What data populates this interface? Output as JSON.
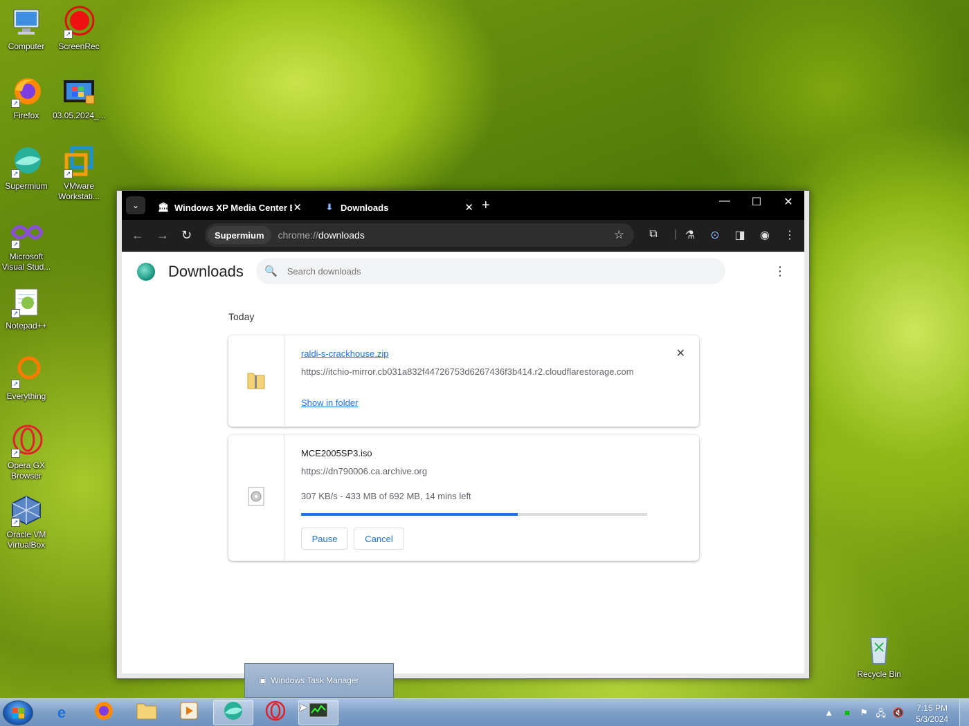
{
  "desktop": {
    "icons": [
      {
        "label": "Computer",
        "icon": "computer-icon"
      },
      {
        "label": "ScreenRec",
        "icon": "screenrec-icon"
      },
      {
        "label": "Firefox",
        "icon": "firefox-icon"
      },
      {
        "label": "03.05.2024_...",
        "icon": "video-file-icon"
      },
      {
        "label": "Supermium",
        "icon": "supermium-icon"
      },
      {
        "label": "VMware Workstati...",
        "icon": "vmware-icon"
      },
      {
        "label": "Microsoft Visual Stud...",
        "icon": "visual-studio-icon"
      },
      {
        "label": "Notepad++",
        "icon": "notepadpp-icon"
      },
      {
        "label": "Everything",
        "icon": "everything-icon"
      },
      {
        "label": "Opera GX Browser",
        "icon": "opera-gx-icon"
      },
      {
        "label": "Oracle VM VirtualBox",
        "icon": "virtualbox-icon"
      },
      {
        "label": "Recycle Bin",
        "icon": "recycle-bin-icon"
      }
    ]
  },
  "browser": {
    "tabs": [
      {
        "title": "Windows XP Media Center Edi",
        "icon": "archive-icon"
      },
      {
        "title": "Downloads",
        "icon": "download-icon"
      }
    ],
    "omnibox": {
      "chip": "Supermium",
      "url_scheme": "chrome://",
      "url_path": "downloads"
    }
  },
  "downloads_page": {
    "title": "Downloads",
    "search_placeholder": "Search downloads",
    "section": "Today",
    "items": [
      {
        "filename": "raldi-s-crackhouse.zip",
        "url": "https://itchio-mirror.cb031a832f44726753d6267436f3b414.r2.cloudflarestorage.com",
        "action": "Show in folder",
        "icon": "zip-folder-icon"
      },
      {
        "filename": "MCE2005SP3.iso",
        "url": "https://dn790006.ca.archive.org",
        "status": "307 KB/s - 433 MB of 692 MB, 14 mins left",
        "progress": 0.626,
        "pause_label": "Pause",
        "cancel_label": "Cancel",
        "icon": "disc-image-icon"
      }
    ]
  },
  "taskbar": {
    "tooltip": "Windows Task Manager",
    "clock_time": "7:15 PM",
    "clock_date": "5/3/2024"
  },
  "colors": {
    "accent": "#1a73e8",
    "tab_bar": "#000000",
    "toolbar": "#1f1f1f"
  }
}
